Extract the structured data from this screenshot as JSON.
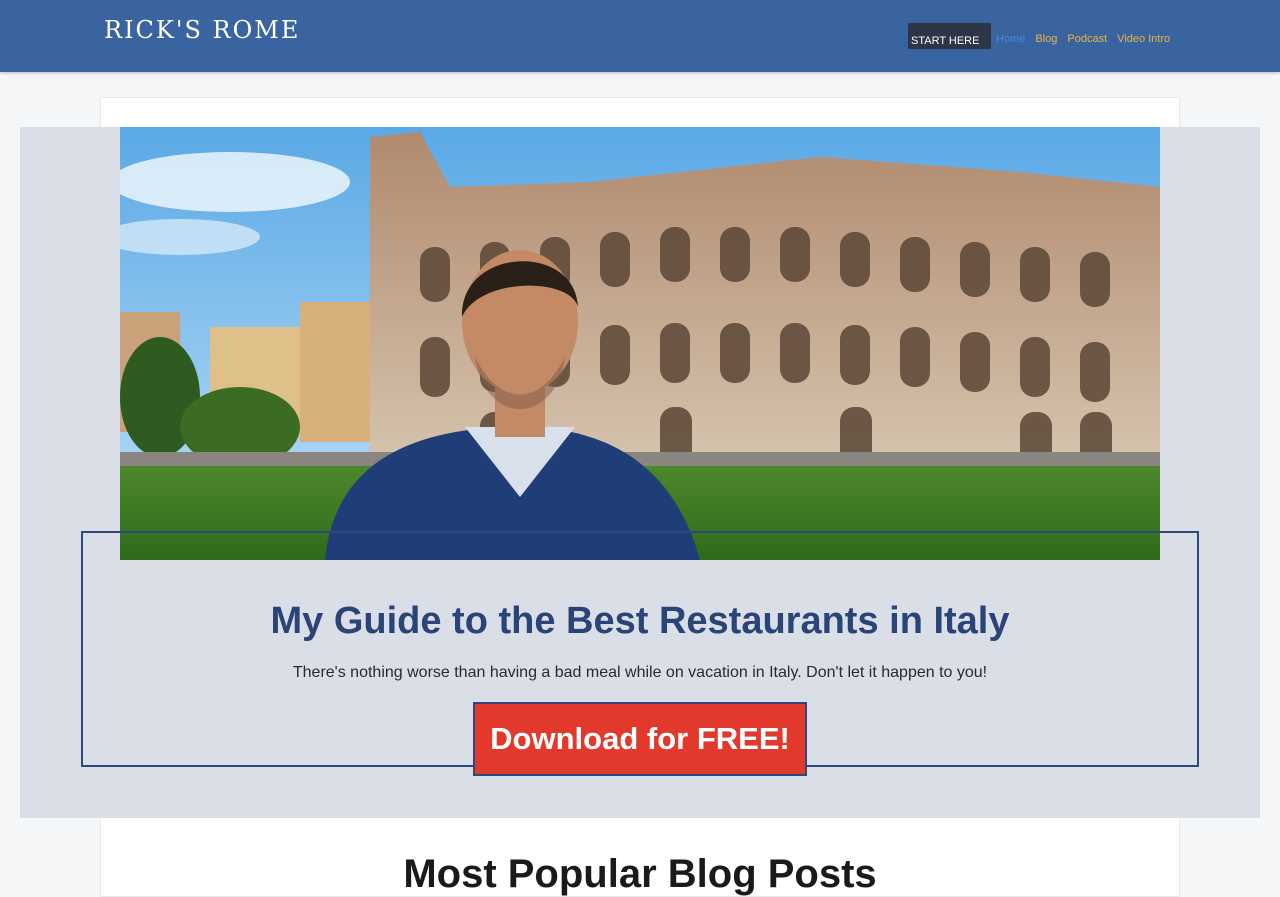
{
  "header": {
    "logo": "RICK'S ROME",
    "nav": {
      "start_here": "START HERE",
      "home": "Home",
      "blog": "Blog",
      "podcast": "Podcast",
      "video_intro": "Video Intro"
    }
  },
  "hero": {
    "image_icon": "colosseum-portrait-photo",
    "title": "My Guide to the Best Restaurants in Italy",
    "subtitle": "There's nothing worse than having a bad meal while on vacation in Italy. Don't let it happen to you!",
    "cta_label": "Download for FREE!"
  },
  "sections": {
    "popular_title": "Most Popular Blog Posts"
  },
  "colors": {
    "header_bg": "#3a64a0",
    "accent_blue": "#2b4478",
    "cta_red": "#e3392d",
    "nav_home": "#4a86e6",
    "nav_gold": "#e8b341"
  }
}
